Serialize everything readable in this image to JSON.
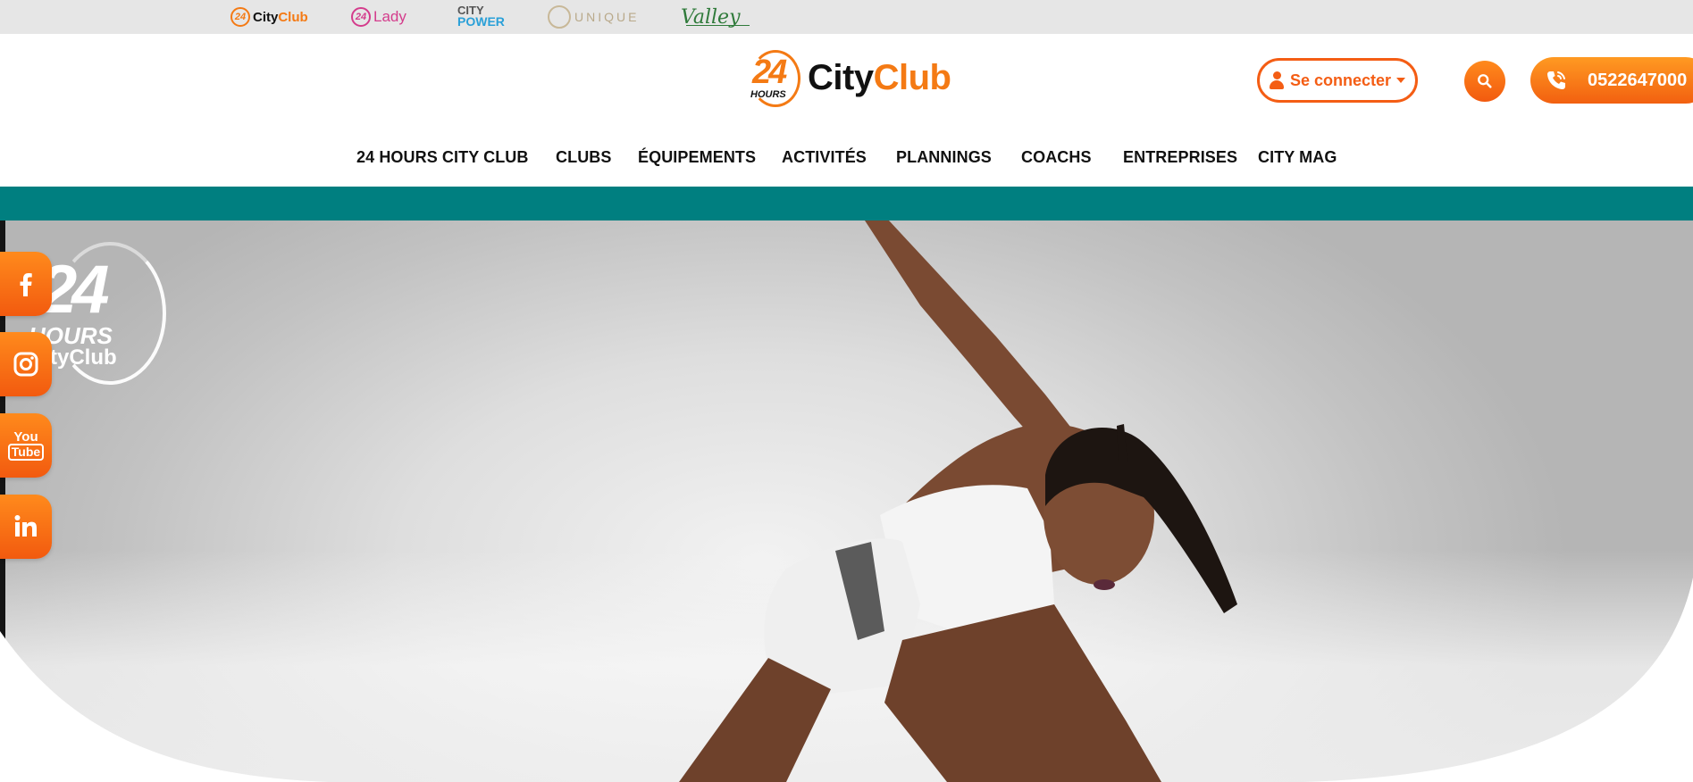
{
  "brand_bar": {
    "items": [
      {
        "num": "24",
        "name_a": "City",
        "name_b": "Club"
      },
      {
        "num": "24",
        "name": "Lady"
      },
      {
        "line1": "CITY",
        "line2": "POWER"
      },
      {
        "name": "UNIQUE"
      },
      {
        "name": "Valley"
      }
    ]
  },
  "header": {
    "logo": {
      "num": "24",
      "hours": "HOURS",
      "name_a": "City",
      "name_b": "Club"
    },
    "login_label": "Se connecter",
    "phone_number": "0522647000"
  },
  "nav": {
    "items": [
      {
        "label": "24 HOURS CITY CLUB"
      },
      {
        "label": "CLUBS"
      },
      {
        "label": "ÉQUIPEMENTS"
      },
      {
        "label": "ACTIVITÉS"
      },
      {
        "label": "PLANNINGS"
      },
      {
        "label": "COACHS"
      },
      {
        "label": "ENTREPRISES"
      },
      {
        "label": "CITY MAG"
      }
    ]
  },
  "hero": {
    "watermark": {
      "num": "24",
      "hours": "HOURS",
      "name": "CityClub"
    }
  },
  "social": {
    "youtube_you": "You",
    "youtube_tube": "Tube"
  },
  "colors": {
    "accent": "#f47a14",
    "teal": "#007f80",
    "topbar": "#e6e6e6"
  }
}
